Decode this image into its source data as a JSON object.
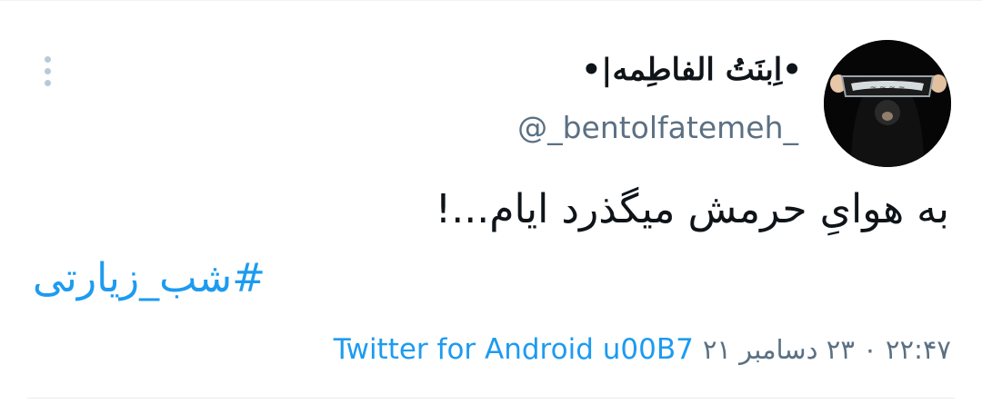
{
  "tweet": {
    "display_name": "•اِبنَتُ الفاطِمه|•",
    "username": "@_bentolfatemeh_",
    "text": "به هوایِ حرمش میگذرد ایام...!",
    "hashtag": "#شب_زیارتی",
    "datetime": "۲۲:۴۷ ۰ ۲۳ دسامبر ۲۱",
    "source": "Twitter for Android u00B7"
  },
  "colors": {
    "text": "#0f1419",
    "secondary": "#5b7083",
    "accent": "#1d9bf0",
    "menu_dots": "#b9cad5"
  },
  "icons": {
    "more": "more-vertical-icon"
  }
}
